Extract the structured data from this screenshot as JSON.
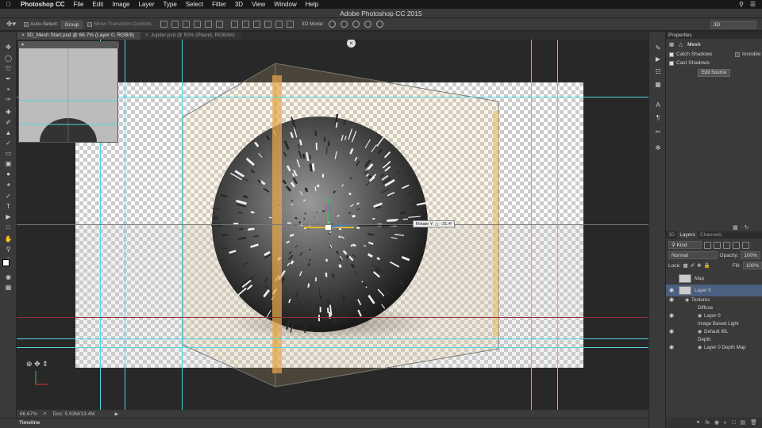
{
  "menubar": {
    "app": "Photoshop CC",
    "items": [
      "File",
      "Edit",
      "Image",
      "Layer",
      "Type",
      "Select",
      "Filter",
      "3D",
      "View",
      "Window",
      "Help"
    ]
  },
  "window": {
    "title": "Adobe Photoshop CC 2015"
  },
  "options_bar": {
    "auto_select_label": "Auto-Select:",
    "auto_select_value": "Group",
    "transform_controls_label": "Show Transform Controls",
    "mode_label": "3D Mode:",
    "workspace": "3D"
  },
  "tabs": [
    {
      "label": "3D_Mesh Start.psd @ 66.7% (Layer 0, RGB/8)",
      "active": true
    },
    {
      "label": "Jupiter.psd @ 50% (Planet, RGB/8#)",
      "active": false
    }
  ],
  "canvas": {
    "rotate_readout": "Rotate Y: △: -31.4°"
  },
  "status": {
    "zoom": "66.67%",
    "doc": "Doc: 5.93M/13.4M"
  },
  "timeline": {
    "label": "Timeline"
  },
  "properties": {
    "title": "Properties",
    "mode": "Mesh",
    "catch_shadows": "Catch Shadows",
    "invisible": "Invisible",
    "cast_shadows": "Cast Shadows",
    "edit_source": "Edit Source"
  },
  "layers_panel": {
    "tabs": [
      "3D",
      "Layers",
      "Channels"
    ],
    "active_tab": "Layers",
    "filter": "Kind",
    "blend_mode": "Normal",
    "opacity_label": "Opacity:",
    "opacity": "100%",
    "lock_label": "Lock:",
    "fill_label": "Fill:",
    "fill": "100%",
    "layers": [
      {
        "name": "Map",
        "indent": 0,
        "visible": false,
        "thumb": true
      },
      {
        "name": "Layer 0",
        "indent": 0,
        "visible": true,
        "thumb": true,
        "selected": true
      },
      {
        "name": "Textures",
        "indent": 1,
        "visible": true
      },
      {
        "name": "Diffuse",
        "indent": 2,
        "visible": false
      },
      {
        "name": "Layer 0",
        "indent": 3,
        "visible": true
      },
      {
        "name": "Image Based Light",
        "indent": 2,
        "visible": false
      },
      {
        "name": "Default IBL",
        "indent": 3,
        "visible": true
      },
      {
        "name": "Depth",
        "indent": 2,
        "visible": false
      },
      {
        "name": "Layer 0 Depth Map",
        "indent": 3,
        "visible": true
      }
    ]
  },
  "colors": {
    "guide": "#4fd6e0",
    "selection_bar": "#f0b040",
    "panel_bg": "#3a3a3a",
    "selected_layer": "#4b5f80"
  }
}
